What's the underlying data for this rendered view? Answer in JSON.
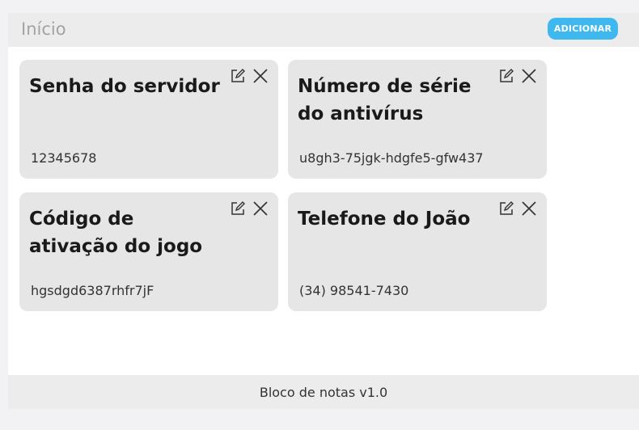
{
  "header": {
    "title": "Início",
    "add_label": "ADICIONAR"
  },
  "colors": {
    "accent": "#3fb8ef",
    "card_background": "#e6e6e6",
    "bar_background": "#ececec"
  },
  "notes": [
    {
      "title": "Senha do servidor",
      "value": "12345678",
      "edit_icon": "edit-icon",
      "delete_icon": "close-icon"
    },
    {
      "title": "Número de série do antivírus",
      "value": "u8gh3-75jgk-hdgfe5-gfw437",
      "edit_icon": "edit-icon",
      "delete_icon": "close-icon"
    },
    {
      "title": "Código de ativação do jogo",
      "value": "hgsdgd6387rhfr7jF",
      "edit_icon": "edit-icon",
      "delete_icon": "close-icon"
    },
    {
      "title": "Telefone do João",
      "value": "(34) 98541-7430",
      "edit_icon": "edit-icon",
      "delete_icon": "close-icon"
    }
  ],
  "footer": {
    "text": "Bloco de notas v1.0"
  }
}
